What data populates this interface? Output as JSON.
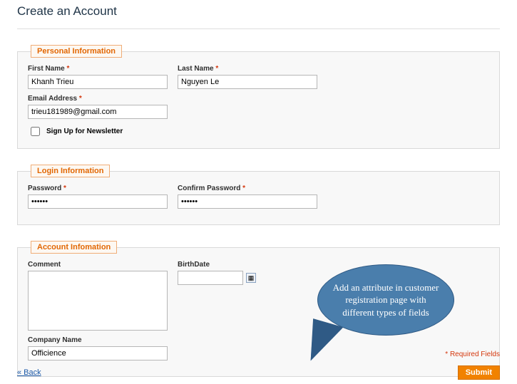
{
  "page": {
    "title": "Create an Account",
    "required_note": "* Required Fields",
    "back_link": "« Back",
    "submit_label": "Submit"
  },
  "personal": {
    "legend": "Personal Information",
    "first_name_label": "First Name",
    "first_name_value": "Khanh Trieu",
    "last_name_label": "Last Name",
    "last_name_value": "Nguyen Le",
    "email_label": "Email Address",
    "email_value": "trieu181989@gmail.com",
    "newsletter_label": "Sign Up for Newsletter"
  },
  "login": {
    "legend": "Login Information",
    "password_label": "Password",
    "password_value": "••••••",
    "confirm_label": "Confirm Password",
    "confirm_value": "••••••"
  },
  "account": {
    "legend": "Account Infomation",
    "comment_label": "Comment",
    "comment_value": "",
    "birthdate_label": "BirthDate",
    "birthdate_value": "",
    "company_label": "Company Name",
    "company_value": "Officience"
  },
  "callout": {
    "text": "Add an attribute in customer registration page with different types of fields"
  },
  "required_marker": "*"
}
